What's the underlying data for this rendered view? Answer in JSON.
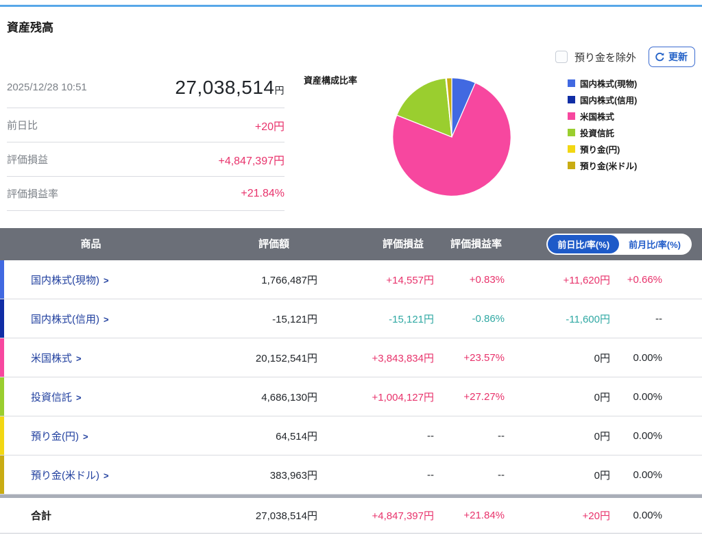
{
  "page": {
    "title": "資産残高"
  },
  "controls": {
    "exclude_checkbox_label": "預り金を除外",
    "checkbox_checked": false,
    "refresh_button_label": "更新"
  },
  "summary": {
    "timestamp": "2025/12/28 10:51",
    "total_value": "27,038,514",
    "total_unit": "円",
    "rows": [
      {
        "label": "前日比",
        "value": "+20円",
        "state": "pos"
      },
      {
        "label": "評価損益",
        "value": "+4,847,397円",
        "state": "pos"
      },
      {
        "label": "評価損益率",
        "value": "+21.84%",
        "state": "pos"
      }
    ]
  },
  "chart_data": {
    "type": "pie",
    "title": "資産構成比率",
    "legend_position": "right",
    "start_angle_deg": 0,
    "direction": "clockwise",
    "slices": [
      {
        "label": "国内株式(現物)",
        "value": 1766487,
        "pct": 6.53,
        "color": "#4169e1"
      },
      {
        "label": "国内株式(信用)",
        "value": -15121,
        "pct": 0,
        "color": "#102da5"
      },
      {
        "label": "米国株式",
        "value": 20152541,
        "pct": 74.49,
        "color": "#f7479f"
      },
      {
        "label": "投資信託",
        "value": 4686130,
        "pct": 17.32,
        "color": "#9ace2f"
      },
      {
        "label": "預り金(円)",
        "value": 64514,
        "pct": 0.24,
        "color": "#f2d713"
      },
      {
        "label": "預り金(米ドル)",
        "value": 383963,
        "pct": 1.42,
        "color": "#c9ac13"
      }
    ]
  },
  "table": {
    "headers": {
      "product": "商品",
      "value": "評価額",
      "pl": "評価損益",
      "rate": "評価損益率"
    },
    "toggle": [
      {
        "label": "前日比/率(%)",
        "selected": true
      },
      {
        "label": "前月比/率(%)",
        "selected": false
      }
    ],
    "rows": [
      {
        "name": "国内株式(現物)",
        "color": "#4169e1",
        "value": "1,766,487円",
        "value_state": "flat",
        "pl": "+14,557円",
        "pl_state": "pos",
        "rate": "+0.83%",
        "rate_state": "pos",
        "day": "+11,620円",
        "day_state": "pos",
        "day_rate": "+0.66%",
        "day_rate_state": "pos"
      },
      {
        "name": "国内株式(信用)",
        "color": "#102da5",
        "value": "-15,121円",
        "value_state": "flat",
        "pl": "-15,121円",
        "pl_state": "neg",
        "rate": "-0.86%",
        "rate_state": "neg",
        "day": "-11,600円",
        "day_state": "neg",
        "day_rate": "--",
        "day_rate_state": "flat"
      },
      {
        "name": "米国株式",
        "color": "#f7479f",
        "value": "20,152,541円",
        "value_state": "flat",
        "pl": "+3,843,834円",
        "pl_state": "pos",
        "rate": "+23.57%",
        "rate_state": "pos",
        "day": "0円",
        "day_state": "flat",
        "day_rate": "0.00%",
        "day_rate_state": "flat"
      },
      {
        "name": "投資信託",
        "color": "#9ace2f",
        "value": "4,686,130円",
        "value_state": "flat",
        "pl": "+1,004,127円",
        "pl_state": "pos",
        "rate": "+27.27%",
        "rate_state": "pos",
        "day": "0円",
        "day_state": "flat",
        "day_rate": "0.00%",
        "day_rate_state": "flat"
      },
      {
        "name": "預り金(円)",
        "color": "#f2d713",
        "value": "64,514円",
        "value_state": "flat",
        "pl": "--",
        "pl_state": "flat",
        "rate": "--",
        "rate_state": "flat",
        "day": "0円",
        "day_state": "flat",
        "day_rate": "0.00%",
        "day_rate_state": "flat"
      },
      {
        "name": "預り金(米ドル)",
        "color": "#c9ac13",
        "value": "383,963円",
        "value_state": "flat",
        "pl": "--",
        "pl_state": "flat",
        "rate": "--",
        "rate_state": "flat",
        "day": "0円",
        "day_state": "flat",
        "day_rate": "0.00%",
        "day_rate_state": "flat"
      }
    ],
    "total": {
      "name": "合計",
      "value": "27,038,514円",
      "value_state": "flat",
      "pl": "+4,847,397円",
      "pl_state": "pos",
      "rate": "+21.84%",
      "rate_state": "pos",
      "day": "+20円",
      "day_state": "pos",
      "day_rate": "0.00%",
      "day_rate_state": "flat"
    }
  }
}
